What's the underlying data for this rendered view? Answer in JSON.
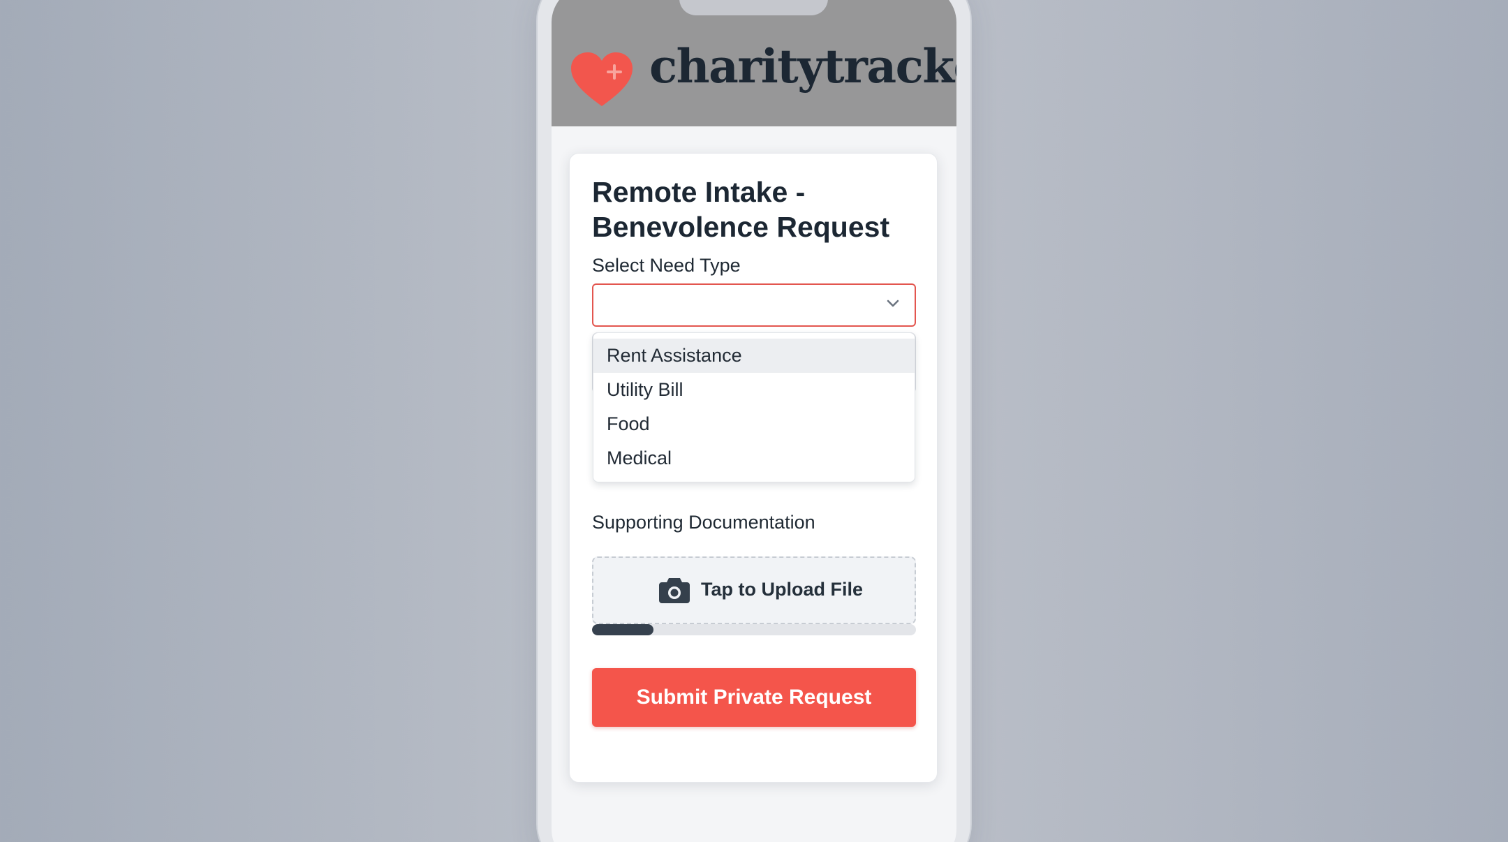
{
  "app": {
    "brand_name": "charitytracker"
  },
  "form": {
    "title": "Remote Intake - Benevolence Request",
    "need_type": {
      "label": "Select Need Type",
      "selected_value": "",
      "options": [
        "Rent Assistance",
        "Utility Bill",
        "Food",
        "Medical"
      ],
      "highlighted_option": "Rent Assistance"
    },
    "documentation": {
      "label": "Supporting Documentation",
      "upload_label": "Tap to Upload File",
      "upload_progress_percent": 19
    },
    "submit_label": "Submit Private Request"
  },
  "icons": {
    "logo": "heart-plus-icon",
    "select": "chevron-down-icon",
    "upload": "camera-icon"
  },
  "colors": {
    "accent": "#f4554b",
    "brand_text": "#1c2733",
    "header_bg": "#979798",
    "progress_fill": "#36414e"
  }
}
